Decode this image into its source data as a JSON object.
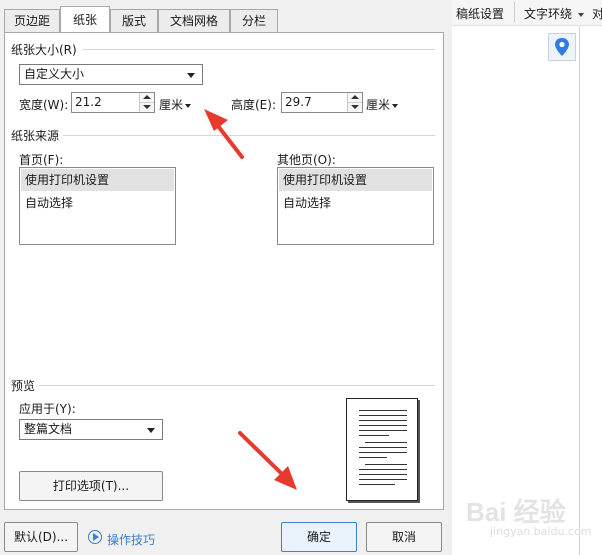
{
  "dialog": {
    "tabs": [
      {
        "label": "页边距",
        "active": false
      },
      {
        "label": "纸张",
        "active": true
      },
      {
        "label": "版式",
        "active": false
      },
      {
        "label": "文档网格",
        "active": false
      },
      {
        "label": "分栏",
        "active": false
      }
    ],
    "paper_size": {
      "section_label": "纸张大小(R)",
      "selected": "自定义大小",
      "width_label": "宽度(W):",
      "width_value": "21.2",
      "width_unit": "厘米",
      "height_label": "高度(E):",
      "height_value": "29.7",
      "height_unit": "厘米"
    },
    "paper_source": {
      "section_label": "纸张来源",
      "first_page_label": "首页(F):",
      "first_page_items": [
        "使用打印机设置",
        "自动选择"
      ],
      "other_pages_label": "其他页(O):",
      "other_pages_items": [
        "使用打印机设置",
        "自动选择"
      ]
    },
    "preview": {
      "section_label": "预览",
      "apply_label": "应用于(Y):",
      "apply_selected": "整篇文档",
      "print_options_button": "打印选项(T)..."
    },
    "footer": {
      "default_button": "默认(D)...",
      "tips_link": "操作技巧",
      "ok_button": "确定",
      "cancel_button": "取消"
    }
  },
  "right_toolbar": {
    "items": [
      "稿纸设置",
      "文字环绕",
      "对"
    ]
  },
  "watermark": {
    "text": "Bai 经验",
    "url": "jingyan.baidu.com"
  },
  "colors": {
    "accent": "#3b7fd0",
    "arrow": "#e8392f",
    "location_pin": "#2f7de1"
  }
}
